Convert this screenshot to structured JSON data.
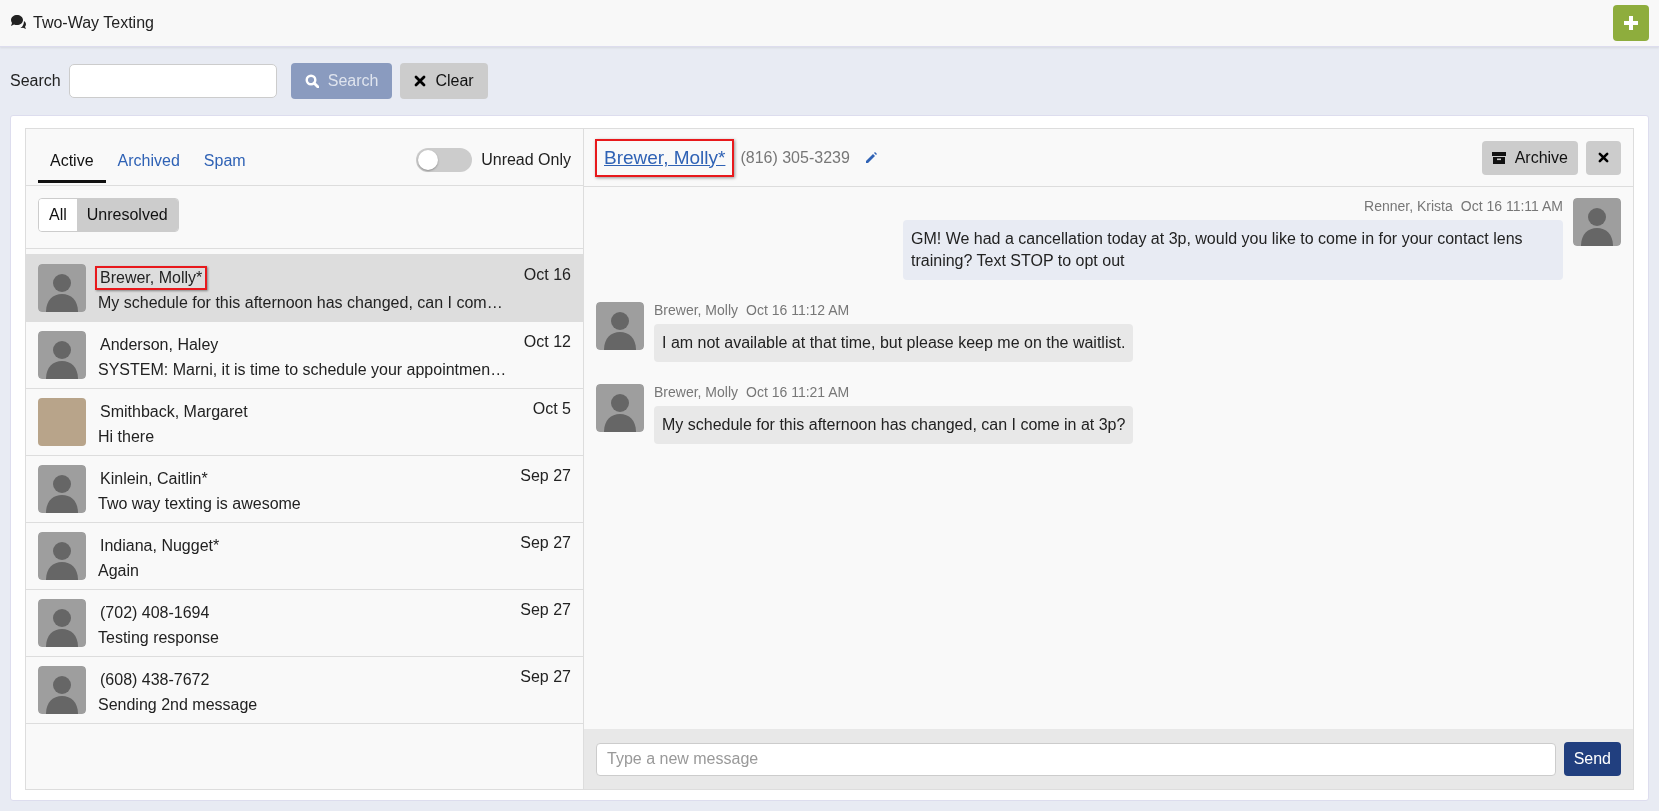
{
  "header": {
    "title": "Two-Way Texting"
  },
  "search": {
    "label": "Search",
    "buttons": [
      {
        "kind": "search",
        "label": "Search",
        "disabled": true
      },
      {
        "kind": "clear",
        "label": "Clear",
        "disabled": false
      }
    ]
  },
  "tabs": [
    {
      "label": "Active",
      "selected": true
    },
    {
      "label": "Archived",
      "selected": false
    },
    {
      "label": "Spam",
      "selected": false
    }
  ],
  "unread_toggle": {
    "label": "Unread Only",
    "on": false
  },
  "filters": [
    {
      "label": "All",
      "selected": false
    },
    {
      "label": "Unresolved",
      "selected": true
    }
  ],
  "conversations": [
    {
      "name": "Brewer, Molly*",
      "date": "Oct 16",
      "preview": "My schedule for this afternoon has changed, can I com…",
      "kind": "silhouette",
      "selected": true,
      "highlighted": true
    },
    {
      "name": "Anderson, Haley",
      "date": "Oct 12",
      "preview": "SYSTEM: Marni, it is time to schedule your appointmen…",
      "kind": "silhouette",
      "selected": false,
      "highlighted": false
    },
    {
      "name": "Smithback, Margaret",
      "date": "Oct 5",
      "preview": "Hi there",
      "kind": "photo",
      "selected": false,
      "highlighted": false
    },
    {
      "name": "Kinlein, Caitlin*",
      "date": "Sep 27",
      "preview": "Two way texting is awesome",
      "kind": "silhouette",
      "selected": false,
      "highlighted": false
    },
    {
      "name": "Indiana, Nugget*",
      "date": "Sep 27",
      "preview": "Again",
      "kind": "silhouette",
      "selected": false,
      "highlighted": false
    },
    {
      "name": "(702) 408-1694",
      "date": "Sep 27",
      "preview": "Testing response",
      "kind": "silhouette",
      "selected": false,
      "highlighted": false
    },
    {
      "name": "(608) 438-7672",
      "date": "Sep 27",
      "preview": "Sending 2nd message",
      "kind": "silhouette",
      "selected": false,
      "highlighted": false
    }
  ],
  "chat": {
    "contact": "Brewer, Molly*",
    "contact_highlighted": true,
    "phone": "(816) 305-3239",
    "archive_label": "Archive",
    "messages": [
      {
        "kind": "outgoing",
        "sender": "Renner, Krista",
        "time": "Oct 16 11:11 AM",
        "text": "GM! We had a cancellation today at 3p, would you like to come in for your contact lens training? Text STOP to opt out"
      },
      {
        "kind": "incoming",
        "sender": "Brewer, Molly",
        "time": "Oct 16 11:12 AM",
        "text": "I am not available at that time, but please keep me on the waitlist."
      },
      {
        "kind": "incoming",
        "sender": "Brewer, Molly",
        "time": "Oct 16 11:21 AM",
        "text": "My schedule for this afternoon has changed, can I come in at 3p?"
      }
    ],
    "composer": {
      "placeholder": "Type a new message",
      "send_label": "Send"
    }
  }
}
